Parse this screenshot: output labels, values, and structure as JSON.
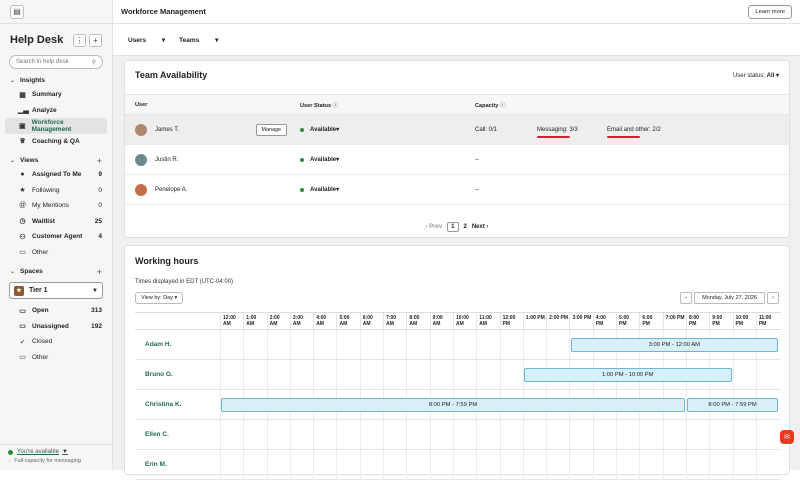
{
  "sidebar": {
    "title": "Help Desk",
    "search_placeholder": "Search in help desk",
    "insights_label": "Insights",
    "insights": [
      "Summary",
      "Analyze",
      "Workforce Management",
      "Coaching & QA"
    ],
    "views_label": "Views",
    "views": [
      {
        "label": "Assigned To Me",
        "count": "9"
      },
      {
        "label": "Following",
        "count": "0"
      },
      {
        "label": "My Mentions",
        "count": "0"
      },
      {
        "label": "Waitlist",
        "count": "25"
      },
      {
        "label": "Customer Agent",
        "count": "4"
      },
      {
        "label": "Other",
        "count": ""
      }
    ],
    "spaces_label": "Spaces",
    "tier": "Tier 1",
    "spaces": [
      {
        "label": "Open",
        "count": "313"
      },
      {
        "label": "Unassigned",
        "count": "192"
      },
      {
        "label": "Closed",
        "count": ""
      },
      {
        "label": "Other",
        "count": ""
      }
    ],
    "availability": "You're available",
    "capacity_note": "Full capacity for messaging"
  },
  "header": {
    "title": "Workforce Management",
    "learn_more": "Learn more"
  },
  "subnav": {
    "users": "Users",
    "teams": "Teams"
  },
  "team": {
    "title": "Team Availability",
    "filter_label": "User status:",
    "filter_value": "All",
    "col_user": "User",
    "col_status": "User Status",
    "col_capacity": "Capacity",
    "manage_label": "Manage",
    "rows": [
      {
        "name": "James T.",
        "status": "Available",
        "call": "Call: 0/1",
        "messaging": "Messaging: 3/3",
        "email": "Email and other: 2/2",
        "avatar": "#b08870"
      },
      {
        "name": "Justin R.",
        "status": "Available",
        "call": "--",
        "messaging": "",
        "email": "",
        "avatar": "#6a8a90"
      },
      {
        "name": "Penelope A.",
        "status": "Available",
        "call": "--",
        "messaging": "",
        "email": "",
        "avatar": "#c0704a"
      }
    ],
    "pager": {
      "prev": "Prev",
      "p1": "1",
      "p2": "2",
      "next": "Next"
    }
  },
  "hours": {
    "title": "Working hours",
    "timezone": "Times displayed in EDT (UTC-04:00)",
    "view_by": "View by: Day",
    "date": "Monday, July 27, 2026",
    "hours": [
      [
        "12:00",
        "AM"
      ],
      [
        "1:00",
        "AM"
      ],
      [
        "2:00",
        "AM"
      ],
      [
        "3:00",
        "AM"
      ],
      [
        "4:00",
        "AM"
      ],
      [
        "5:00",
        "AM"
      ],
      [
        "6:00",
        "AM"
      ],
      [
        "7:00",
        "AM"
      ],
      [
        "8:00",
        "AM"
      ],
      [
        "9:00",
        "AM"
      ],
      [
        "10:00",
        "AM"
      ],
      [
        "11:00",
        "AM"
      ],
      [
        "12:00",
        "PM"
      ],
      [
        "1:00 PM",
        ""
      ],
      [
        "2:00 PM",
        ""
      ],
      [
        "3:00 PM",
        ""
      ],
      [
        "4:00",
        "PM"
      ],
      [
        "5:00",
        "PM"
      ],
      [
        "6:00",
        "PM"
      ],
      [
        "7:00 PM",
        ""
      ],
      [
        "8:00",
        "PM"
      ],
      [
        "9:00",
        "PM"
      ],
      [
        "10:00",
        "PM"
      ],
      [
        "11:00",
        "PM"
      ]
    ],
    "people": [
      {
        "name": "Adam H.",
        "shifts": [
          {
            "start": 15,
            "end": 24,
            "label": "3:00 PM - 12:00 AM"
          }
        ]
      },
      {
        "name": "Bruno G.",
        "shifts": [
          {
            "start": 13,
            "end": 22,
            "label": "1:00 PM - 10:00 PM"
          }
        ]
      },
      {
        "name": "Christina K.",
        "shifts": [
          {
            "start": 0,
            "end": 20,
            "label": "8:00 PM - 7:59 PM"
          },
          {
            "start": 20,
            "end": 24,
            "label": "8:00 PM - 7:59 PM"
          }
        ]
      },
      {
        "name": "Ellen C.",
        "shifts": []
      },
      {
        "name": "Erin M.",
        "shifts": []
      }
    ]
  }
}
